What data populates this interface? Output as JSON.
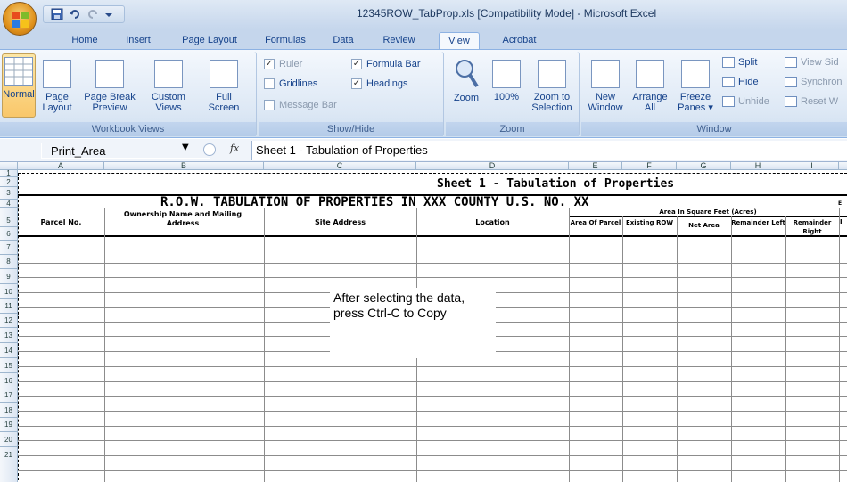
{
  "window": {
    "title": "12345ROW_TabProp.xls  [Compatibility Mode]  -  Microsoft Excel"
  },
  "tabs": [
    "Home",
    "Insert",
    "Page Layout",
    "Formulas",
    "Data",
    "Review",
    "View",
    "Acrobat"
  ],
  "active_tab": "View",
  "ribbon": {
    "workbook_views": {
      "label": "Workbook Views",
      "normal": "Normal",
      "page_layout": [
        "Page",
        "Layout"
      ],
      "page_break": [
        "Page Break",
        "Preview"
      ],
      "custom_views": [
        "Custom",
        "Views"
      ],
      "full_screen": [
        "Full",
        "Screen"
      ]
    },
    "show_hide": {
      "label": "Show/Hide",
      "ruler": "Ruler",
      "gridlines": "Gridlines",
      "message_bar": "Message Bar",
      "formula_bar": "Formula Bar",
      "headings": "Headings"
    },
    "zoom": {
      "label": "Zoom",
      "zoom": "Zoom",
      "hundred": "100%",
      "zoom_to_selection": [
        "Zoom to",
        "Selection"
      ]
    },
    "window": {
      "label": "Window",
      "new_window": [
        "New",
        "Window"
      ],
      "arrange_all": [
        "Arrange",
        "All"
      ],
      "freeze_panes": [
        "Freeze",
        "Panes ▾"
      ],
      "split": "Split",
      "hide": "Hide",
      "unhide": "Unhide",
      "view_side": "View Sid",
      "synchro": "Synchron",
      "reset": "Reset W"
    }
  },
  "formula_bar": {
    "name_box": "Print_Area",
    "fx": "fx",
    "content": "Sheet 1 - Tabulation of Properties"
  },
  "columns": [
    "A",
    "B",
    "C",
    "D",
    "E",
    "F",
    "G",
    "H",
    "I"
  ],
  "rows": [
    "1",
    "2",
    "3",
    "4",
    "5",
    "6",
    "7",
    "8",
    "9",
    "10",
    "11",
    "12",
    "13",
    "14",
    "15",
    "16",
    "17",
    "18",
    "19",
    "20",
    "21"
  ],
  "sheet": {
    "title": "Sheet 1 - Tabulation of Properties",
    "heading": "R.O.W. TABULATION OF PROPERTIES IN XXX COUNTY  U.S. NO. XX",
    "h_parcel": "Parcel No.",
    "h_owner": "Ownership Name and Mailing Address",
    "h_site": "Site Address",
    "h_location": "Location",
    "h_area_group": "Area In Square Feet (Acres)",
    "h_area_parcel": "Area Of Parcel",
    "h_existing_row": "Existing ROW",
    "h_net_area": "Net Area",
    "h_rem_left": "Remainder Left",
    "h_rem_right": "Remainder Right",
    "h_cut_j3": "E",
    "h_cut_j5": "I"
  },
  "callout": "After selecting the data, press Ctrl-C to Copy"
}
